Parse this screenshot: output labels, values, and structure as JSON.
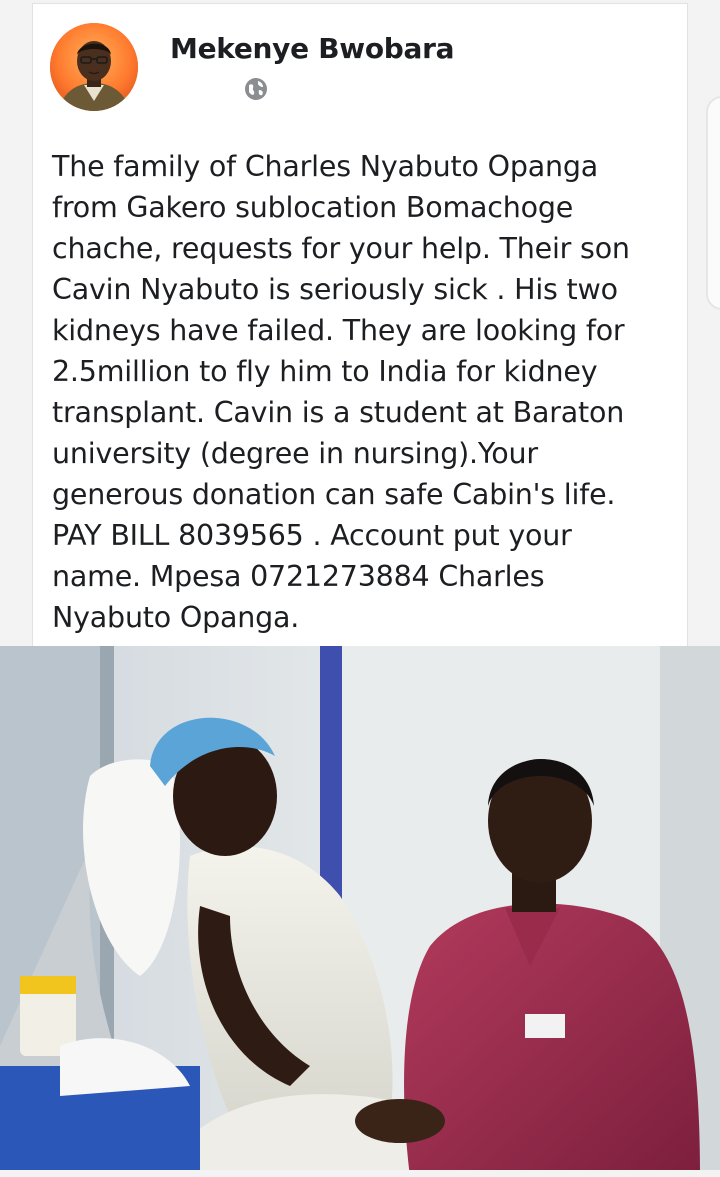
{
  "post": {
    "author_name": "Mekenye Bwobara",
    "privacy_icon": "globe-icon",
    "body_text": "The family of Charles Nyabuto Opanga\nfrom Gakero sublocation Bomachoge\nchache, requests for your help. Their son\nCavin Nyabuto is seriously sick . His two\nkidneys have failed. They are looking for\n2.5million to fly him to India for kidney\ntransplant. Cavin is a student at Baraton\nuniversity (degree in nursing).Your\ngenerous donation can safe Cabin's life.\nPAY BILL 8039565 . Account put your\nname. Mpesa 0721273884 Charles\nNyabuto Opanga."
  },
  "colors": {
    "name_text": "#1c1e21",
    "card_background": "#ffffff",
    "avatar_background": "#ff7a2e"
  }
}
